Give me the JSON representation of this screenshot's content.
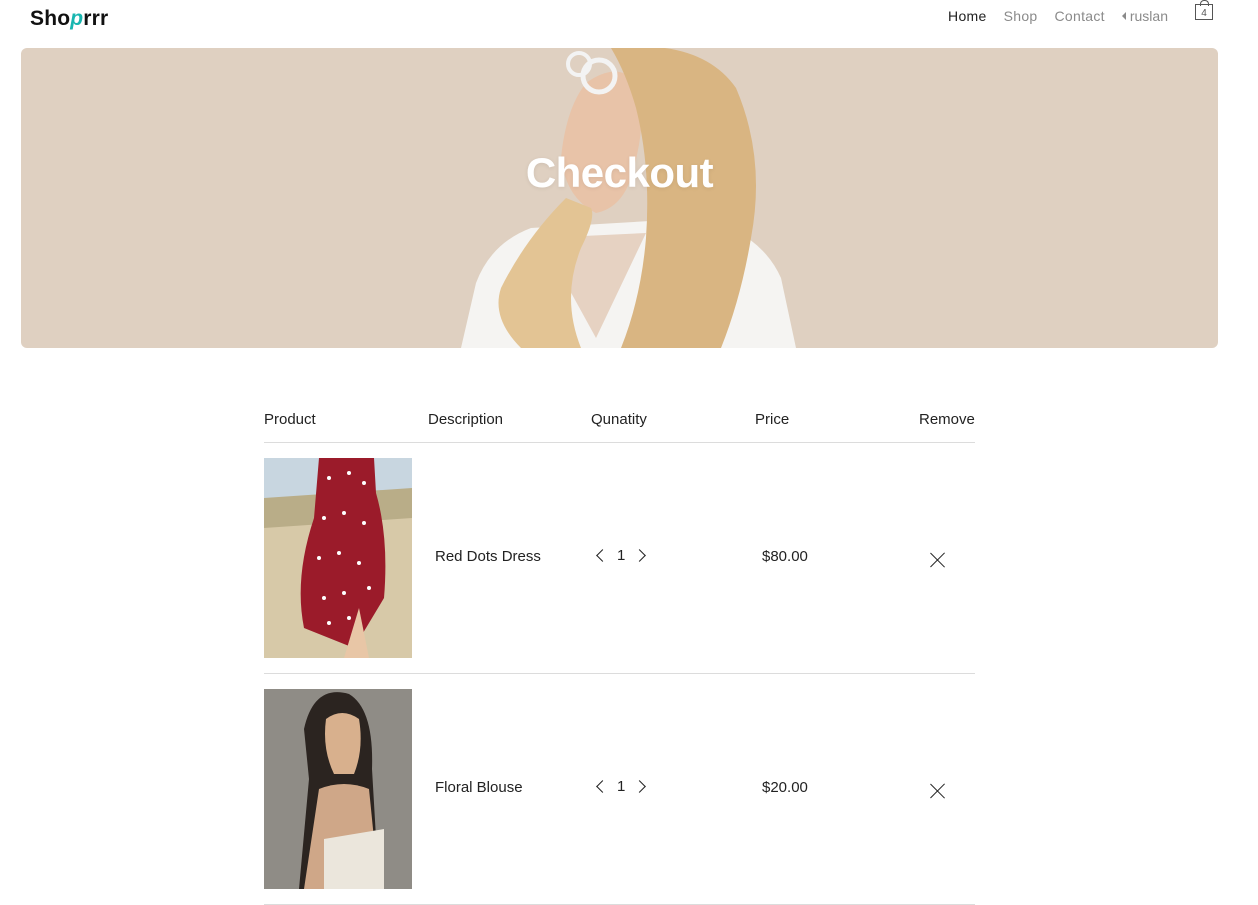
{
  "header": {
    "logo_prefix": "Sho",
    "logo_mark": "p",
    "logo_suffix": "rrr",
    "nav": [
      "Home",
      "Shop",
      "Contact"
    ],
    "user": "ruslan",
    "cart_count": "4"
  },
  "hero": {
    "title": "Checkout"
  },
  "table": {
    "headers": [
      "Product",
      "Description",
      "Qunatity",
      "Price",
      "Remove"
    ],
    "rows": [
      {
        "description": "Red Dots Dress",
        "quantity": "1",
        "price": "$80.00"
      },
      {
        "description": "Floral Blouse",
        "quantity": "1",
        "price": "$20.00"
      }
    ]
  },
  "colors": {
    "accent": "#18b6b0",
    "hero_bg": "#dfd0c1",
    "dress": "#9b1b2a"
  },
  "icons": [
    "cart-icon",
    "chevron-left-icon",
    "chevron-right-icon",
    "close-icon",
    "caret-left-icon"
  ]
}
